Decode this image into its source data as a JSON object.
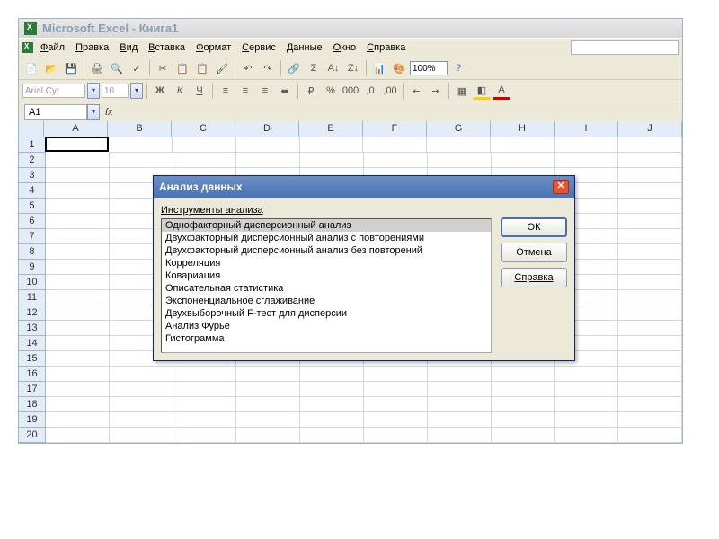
{
  "title": "Microsoft Excel - Книга1",
  "menus": [
    "Файл",
    "Правка",
    "Вид",
    "Вставка",
    "Формат",
    "Сервис",
    "Данные",
    "Окно",
    "Справка"
  ],
  "zoom": "100%",
  "font_name": "Arial Cyr",
  "font_size": "10",
  "namebox": "A1",
  "fx_label": "fx",
  "columns": [
    "A",
    "B",
    "C",
    "D",
    "E",
    "F",
    "G",
    "H",
    "I",
    "J"
  ],
  "row_count": 20,
  "dialog": {
    "title": "Анализ данных",
    "label": "Инструменты анализа",
    "options": [
      "Однофакторный дисперсионный анализ",
      "Двухфакторный дисперсионный анализ с повторениями",
      "Двухфакторный дисперсионный анализ без повторений",
      "Корреляция",
      "Ковариация",
      "Описательная статистика",
      "Экспоненциальное сглаживание",
      "Двухвыборочный F-тест для дисперсии",
      "Анализ Фурье",
      "Гистограмма"
    ],
    "selected_index": 0,
    "buttons": {
      "ok": "ОК",
      "cancel": "Отмена",
      "help": "Справка"
    }
  },
  "toolbar_icons": [
    "new",
    "open",
    "save",
    "print",
    "preview",
    "spell",
    "cut",
    "copy",
    "paste",
    "format-painter",
    "undo",
    "redo",
    "link",
    "autosum",
    "sort-asc",
    "sort-desc",
    "chart",
    "drawing",
    "zoom-dd",
    "help"
  ]
}
